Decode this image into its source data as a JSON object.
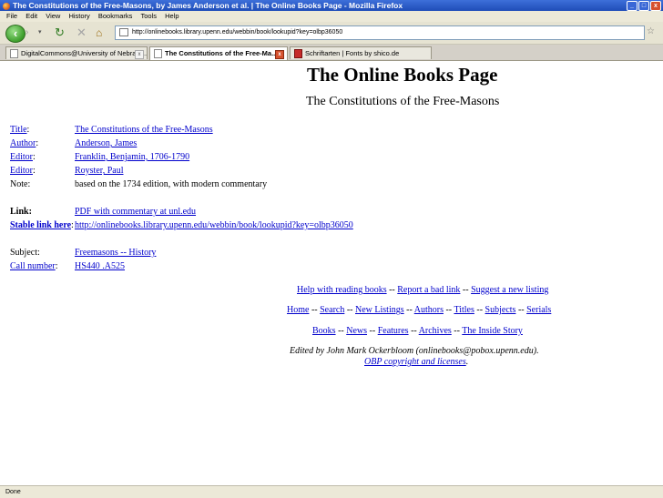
{
  "window": {
    "title": "The Constitutions of the Free-Masons, by James Anderson et al. | The Online Books Page - Mozilla Firefox",
    "minimize": "_",
    "maximize": "□",
    "close": "x"
  },
  "menu": [
    "File",
    "Edit",
    "View",
    "History",
    "Bookmarks",
    "Tools",
    "Help"
  ],
  "nav": {
    "url": "http://onlinebooks.library.upenn.edu/webbin/book/lookupid?key=olbp36050"
  },
  "tabs": [
    {
      "label": "DigitalCommons@University of Nebrask...",
      "active": false
    },
    {
      "label": "The Constitutions of the Free-Ma...",
      "active": true
    },
    {
      "label": "Schriftarten | Fonts by shico.de",
      "active": false
    }
  ],
  "page": {
    "site_title": "The Online Books Page",
    "book_title": "The Constitutions of the Free-Masons",
    "fields": [
      {
        "label": "Title",
        "suffix": ":",
        "label_link": true,
        "value": "The Constitutions of the Free-Masons",
        "value_link": true
      },
      {
        "label": "Author",
        "suffix": ":",
        "label_link": true,
        "value": "Anderson, James",
        "value_link": true
      },
      {
        "label": "Editor",
        "suffix": ":",
        "label_link": true,
        "value": "Franklin, Benjamin, 1706-1790",
        "value_link": true
      },
      {
        "label": "Editor",
        "suffix": ":",
        "label_link": true,
        "value": "Royster, Paul",
        "value_link": true
      },
      {
        "label": "Note:",
        "suffix": "",
        "label_link": false,
        "value": "based on the 1734 edition, with modern commentary",
        "value_link": false
      }
    ],
    "link_label": "Link:",
    "link_value": "PDF with commentary at unl.edu",
    "stable_label": "Stable link here",
    "stable_suffix": ":",
    "stable_value": "http://onlinebooks.library.upenn.edu/webbin/book/lookupid?key=olbp36050",
    "subject_label": "Subject:",
    "subject_value": "Freemasons -- History",
    "call_label": "Call number",
    "call_suffix": ":",
    "call_value": "HS440 .A525",
    "help_links": {
      "help": "Help with reading books",
      "report": "Report a bad link",
      "suggest": "Suggest a new listing",
      "sep": " -- "
    },
    "nav_links": {
      "home": "Home",
      "search": "Search",
      "new": "New Listings",
      "authors": "Authors",
      "titles": "Titles",
      "subjects": "Subjects",
      "serials": "Serials"
    },
    "book_links": {
      "books": "Books",
      "news": "News",
      "features": "Features",
      "archives": "Archives",
      "inside": "The Inside Story"
    },
    "edited_by": "Edited by John Mark Ockerbloom (onlinebooks@pobox.upenn.edu).",
    "copyright": "OBP copyright and licenses",
    "copyright_end": "."
  },
  "status": {
    "text": "Done"
  }
}
